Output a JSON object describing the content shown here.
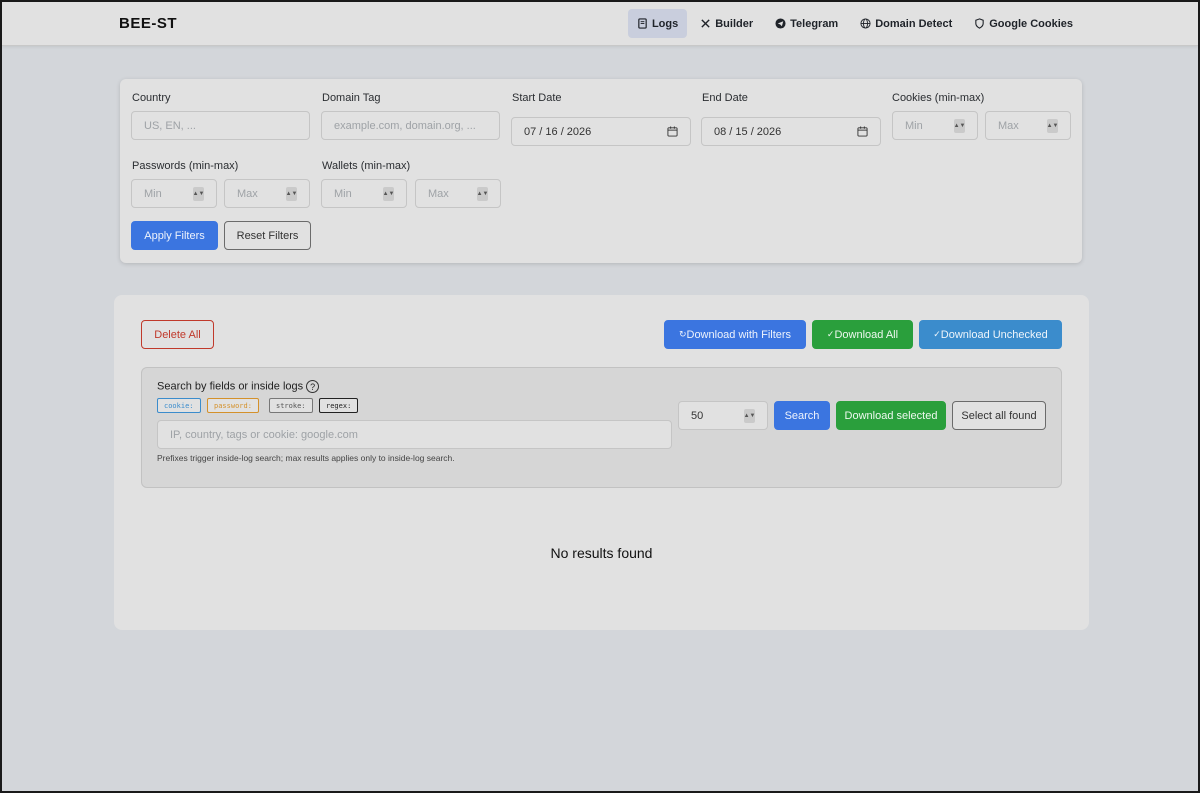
{
  "brand": "BEE-ST",
  "nav": [
    {
      "label": "Logs",
      "icon": "logs-icon",
      "active": true
    },
    {
      "label": "Builder",
      "icon": "tools-icon"
    },
    {
      "label": "Telegram",
      "icon": "telegram-icon"
    },
    {
      "label": "Domain Detect",
      "icon": "globe-icon"
    },
    {
      "label": "Google Cookies",
      "icon": "shield-icon"
    }
  ],
  "filters": {
    "country": {
      "label": "Country",
      "placeholder": "US, EN, ..."
    },
    "domain_tag": {
      "label": "Domain Tag",
      "placeholder": "example.com, domain.org, ..."
    },
    "start_date": {
      "label": "Start Date",
      "value": "07 / 16 / 2026"
    },
    "end_date": {
      "label": "End Date",
      "value": "08 / 15 / 2026"
    },
    "cookies": {
      "label": "Cookies (min-max)",
      "min": "Min",
      "max": "Max"
    },
    "passwords": {
      "label": "Passwords (min-max)",
      "min": "Min",
      "max": "Max"
    },
    "wallets": {
      "label": "Wallets (min-max)",
      "min": "Min",
      "max": "Max"
    },
    "apply_label": "Apply Filters",
    "reset_label": "Reset Filters"
  },
  "actions": {
    "delete_all": "Delete All",
    "download_filters": "Download with Filters",
    "download_all": "Download All",
    "download_unchecked": "Download Unchecked"
  },
  "search": {
    "title": "Search by fields or inside logs",
    "help": "?",
    "chips": [
      "cookie:",
      "password:",
      "stroke:",
      "regex:"
    ],
    "placeholder": "IP, country, tags or cookie: google.com",
    "hint": "Prefixes trigger inside-log search; max results applies only to inside-log search.",
    "max_results": "50",
    "search_label": "Search",
    "download_selected": "Download selected",
    "select_all": "Select all found"
  },
  "empty_message": "No results found",
  "colors": {
    "primary": "#3b75e0",
    "success": "#2a9f3c",
    "info": "#3b8ccc",
    "danger": "#c0392b"
  }
}
